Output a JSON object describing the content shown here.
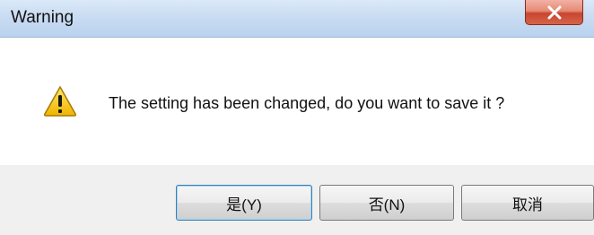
{
  "dialog": {
    "title": "Warning",
    "message": "The setting has been changed, do you want to save it ?",
    "icon": "warning-icon"
  },
  "buttons": {
    "yes_label": "是(Y)",
    "no_label": "否(N)",
    "cancel_label": "取消"
  },
  "colors": {
    "close_button": "#c8452f",
    "titlebar": "#c9dcf2",
    "button_area": "#f0f0f0",
    "warning_icon": "#f4c400"
  }
}
